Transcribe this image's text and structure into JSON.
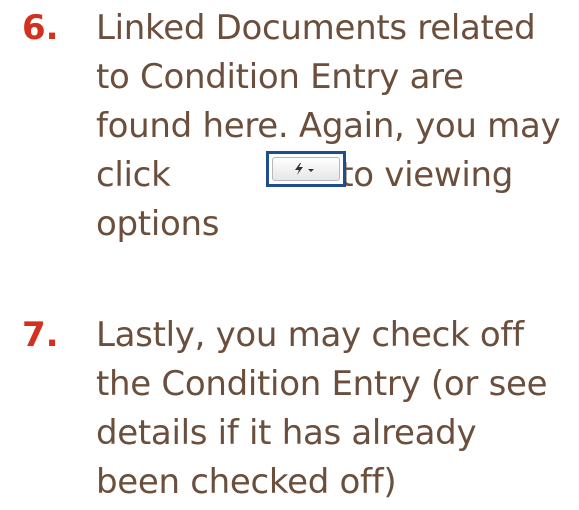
{
  "steps": [
    {
      "number": "6.",
      "lines": [
        "Linked Documents related",
        "to Condition Entry are",
        "found here. Again, you may",
        "click",
        "hoto viewing",
        "options"
      ]
    },
    {
      "number": "7.",
      "lines": [
        "Lastly, you may check off",
        "the Condition Entry (or see",
        "details if it has already",
        "been checked off)"
      ]
    }
  ],
  "icons": {
    "options_button": [
      "lightning-icon",
      "caret-down-icon"
    ]
  },
  "colors": {
    "step_number": "#d4301f",
    "body_text": "#6b4f3c",
    "button_highlight": "#1f4f8b"
  }
}
